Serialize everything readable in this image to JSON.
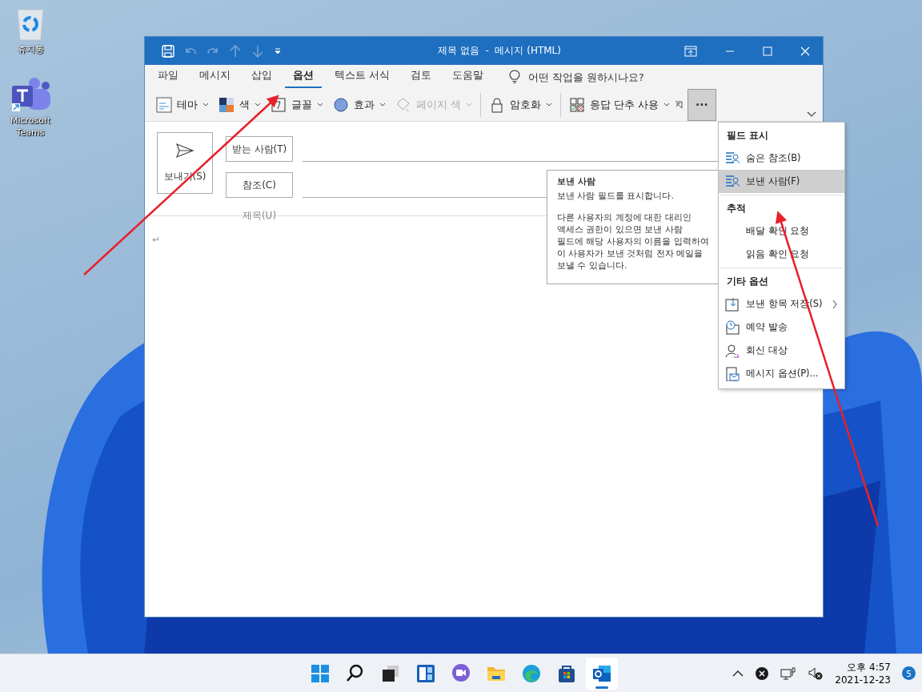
{
  "desktop_icons": [
    {
      "kind": "recycle",
      "label": "휴지통"
    },
    {
      "kind": "teams",
      "label": "Microsoft Teams"
    }
  ],
  "window": {
    "title": "제목 없음  -  메시지 (HTML)"
  },
  "ribbon_tabs": [
    {
      "label": "파일",
      "selected": false
    },
    {
      "label": "메시지",
      "selected": false
    },
    {
      "label": "삽입",
      "selected": false
    },
    {
      "label": "옵션",
      "selected": true
    },
    {
      "label": "텍스트 서식",
      "selected": false
    },
    {
      "label": "검토",
      "selected": false
    },
    {
      "label": "도움말",
      "selected": false
    }
  ],
  "tell_me": {
    "placeholder": "어떤 작업을 원하시나요?"
  },
  "ribbon_commands": [
    {
      "kind": "theme",
      "label": "테마",
      "disabled": false,
      "separator_after": false
    },
    {
      "kind": "colors",
      "label": "색",
      "disabled": false,
      "separator_after": false
    },
    {
      "kind": "fonts",
      "label": "글꼴",
      "disabled": false,
      "separator_after": false
    },
    {
      "kind": "effects",
      "label": "효과",
      "disabled": false,
      "separator_after": false
    },
    {
      "kind": "page-color",
      "label": "페이지 색",
      "disabled": true,
      "separator_after": true
    },
    {
      "kind": "lock",
      "label": "암호화",
      "disabled": false,
      "separator_after": true
    },
    {
      "kind": "voting",
      "label": "응답 단추 사용",
      "disabled": false,
      "separator_after": false
    }
  ],
  "more_button": {
    "label": "···",
    "pressed": true
  },
  "compose": {
    "send": "보내기(S)",
    "to": "받는 사람(T)",
    "cc": "참조(C)",
    "subject": "제목(U)",
    "body_mark": "↵"
  },
  "tooltip": {
    "title": "보낸 사람",
    "paragraphs": [
      "보낸 사람 필드를 표시합니다.",
      "다른 사용자의 계정에 대한 대리인 액세스 권한이 있으면 보낸 사람 필드에 해당 사용자의 이름을 입력하여 이 사용자가 보낸 것처럼 전자 메일을 보낼 수 있습니다."
    ]
  },
  "menu": {
    "sections": [
      {
        "heading": "필드 표시",
        "items": [
          {
            "kind": "field",
            "label": "숨은 참조(B)",
            "selected": false,
            "submenu": false
          },
          {
            "kind": "field",
            "label": "보낸 사람(F)",
            "selected": true,
            "submenu": false
          }
        ]
      },
      {
        "heading": "추적",
        "items": [
          {
            "kind": "plain",
            "label": "배달 확인 요청",
            "selected": false,
            "submenu": false
          },
          {
            "kind": "plain",
            "label": "읽음 확인 요청",
            "selected": false,
            "submenu": false
          }
        ]
      },
      {
        "heading": "기타 옵션",
        "items": [
          {
            "kind": "save",
            "label": "보낸 항목 저장(S)",
            "selected": false,
            "submenu": true
          },
          {
            "kind": "schedule",
            "label": "예약 발송",
            "selected": false,
            "submenu": false
          },
          {
            "kind": "reply",
            "label": "회신 대상",
            "selected": false,
            "submenu": false
          },
          {
            "kind": "options",
            "label": "메시지 옵션(P)...",
            "selected": false,
            "submenu": false
          }
        ]
      }
    ]
  },
  "taskbar": {
    "apps": [
      {
        "kind": "start",
        "selected": false
      },
      {
        "kind": "search",
        "selected": false
      },
      {
        "kind": "taskview",
        "selected": false
      },
      {
        "kind": "widgets",
        "selected": false
      },
      {
        "kind": "chat",
        "selected": false
      },
      {
        "kind": "explorer",
        "selected": false
      },
      {
        "kind": "edge",
        "selected": false
      },
      {
        "kind": "store",
        "selected": false
      },
      {
        "kind": "outlook",
        "selected": true
      }
    ],
    "time": "오후 4:57",
    "date": "2021-12-23",
    "notifications": "5"
  }
}
